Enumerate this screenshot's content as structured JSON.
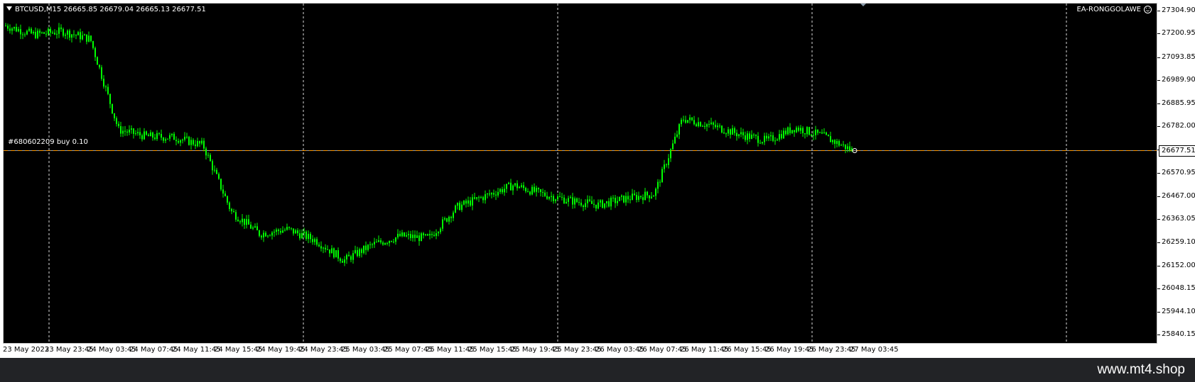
{
  "window": {
    "symbol_info": "BTCUSD,M15  26665.85 26679.04 26665.13 26677.51",
    "ea_label": "EA-RONGGOLAWE",
    "ea_icon": "smile-icon"
  },
  "order": {
    "id": "#680602209",
    "text": "buy 0.10"
  },
  "bid_label": "26677.51",
  "price_axis": [
    "27304.90",
    "27200.95",
    "27093.85",
    "26989.90",
    "26885.95",
    "26782.00",
    "26677.51",
    "26570.95",
    "26467.00",
    "26363.05",
    "26259.10",
    "26152.00",
    "26048.15",
    "25944.10",
    "25840.15"
  ],
  "time_axis": [
    "23 May 2023",
    "23 May 23:45",
    "24 May 03:45",
    "24 May 07:45",
    "24 May 11:45",
    "24 May 15:45",
    "24 May 19:45",
    "24 May 23:45",
    "25 May 03:45",
    "25 May 07:45",
    "25 May 11:45",
    "25 May 15:45",
    "25 May 19:45",
    "25 May 23:45",
    "26 May 03:45",
    "26 May 07:45",
    "26 May 11:45",
    "26 May 15:45",
    "26 May 19:45",
    "26 May 23:45",
    "27 May 03:45"
  ],
  "footer": {
    "site": "www.mt4.shop"
  },
  "colors": {
    "background": "#000000",
    "candles": "#00ff00",
    "order_line": "#ff9900",
    "bid_line": "#a0a0a0",
    "grid": "#ffffff"
  },
  "chart_data": {
    "type": "line",
    "title": "",
    "xlabel": "",
    "ylabel": "",
    "ylim": [
      25800,
      27340
    ],
    "x": [
      "23 May 2023",
      "23 May 23:45",
      "24 May 03:45",
      "24 May 07:45",
      "24 May 11:45",
      "24 May 15:45",
      "24 May 19:45",
      "24 May 23:45",
      "25 May 03:45",
      "25 May 07:45",
      "25 May 11:45",
      "25 May 15:45",
      "25 May 19:45",
      "25 May 23:45",
      "26 May 03:45",
      "26 May 07:45",
      "26 May 11:45",
      "26 May 15:45",
      "26 May 19:45",
      "26 May 23:45",
      "27 May 03:45"
    ],
    "series": [
      {
        "values": [
          27240,
          27200,
          27215,
          27180,
          26770,
          26740,
          26735,
          26700,
          26400,
          26300,
          26320,
          26270,
          26180,
          26250,
          26290,
          26280,
          26420,
          26470,
          26520,
          26480,
          26450,
          26430,
          26460,
          26480,
          26820,
          26790,
          26750,
          26720,
          26780,
          26740,
          26678
        ]
      }
    ],
    "order_level": 26677.51,
    "bid_level": 26677.51,
    "grid": true
  }
}
